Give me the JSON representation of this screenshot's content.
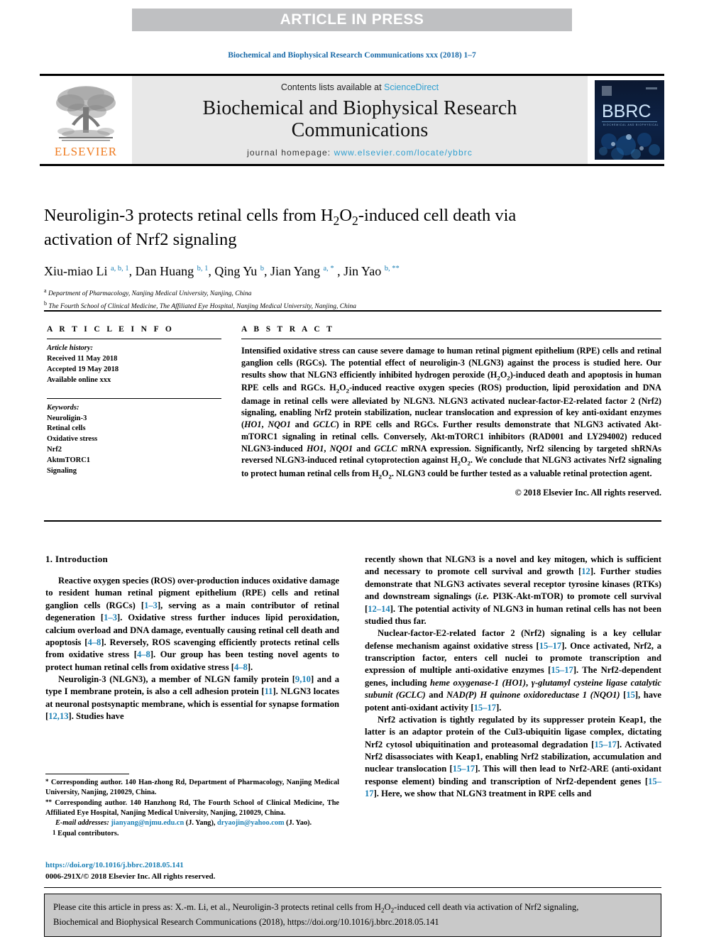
{
  "banner": {
    "text": "ARTICLE IN PRESS"
  },
  "journal_ref": "Biochemical and Biophysical Research Communications xxx (2018) 1–7",
  "masthead": {
    "contents_prefix": "Contents lists available at ",
    "sciencedirect": "ScienceDirect",
    "journal_title": "Biochemical and Biophysical Research Communications",
    "homepage_prefix": "journal homepage: ",
    "homepage_url": "www.elsevier.com/locate/ybbrc",
    "publisher": "ELSEVIER",
    "cover_label": "BBRC"
  },
  "article": {
    "title_line1": "Neuroligin-3 protects retinal cells from H",
    "title_sub1": "2",
    "title_mid": "O",
    "title_sub2": "2",
    "title_line1b": "-induced cell death via",
    "title_line2": "activation of Nrf2 signaling",
    "authors_html": "Xiu-miao Li <sup>a, b, 1</sup>, Dan Huang <sup>b, 1</sup>, Qing Yu <sup>b</sup>, Jian Yang <sup>a, *</sup> , Jin Yao <sup>b, **</sup>",
    "affiliation_a": "Department of Pharmacology, Nanjing Medical University, Nanjing, China",
    "affiliation_b": "The Fourth School of Clinical Medicine, The Affiliated Eye Hospital, Nanjing Medical University, Nanjing, China"
  },
  "article_info": {
    "heading": "A R T I C L E  I N F O",
    "history_label": "Article history:",
    "received": "Received 11 May 2018",
    "accepted": "Accepted 19 May 2018",
    "available": "Available online xxx",
    "keywords_label": "Keywords:",
    "keywords": [
      "Neuroligin-3",
      "Retinal cells",
      "Oxidative stress",
      "Nrf2",
      "AktmTORC1",
      "Signaling"
    ]
  },
  "abstract": {
    "heading": "A B S T R A C T",
    "copyright": "© 2018 Elsevier Inc. All rights reserved."
  },
  "sections": {
    "introduction_heading": "1. Introduction"
  },
  "footnotes": {
    "corr1": "Corresponding author. 140 Han-zhong Rd, Department of Pharmacology, Nanjing Medical University, Nanjing, 210029, China.",
    "corr2": "Corresponding author. 140 Hanzhong Rd, The Fourth School of Clinical Medicine, The Affiliated Eye Hospital, Nanjing Medical University, Nanjing, 210029, China.",
    "email_label": "E-mail addresses:",
    "email1": "jianyang@njmu.edu.cn",
    "email1_who": "(J. Yang)",
    "email2": "dryaojin@yahoo.com",
    "email2_who": "(J. Yao).",
    "equal": "Equal contributors.",
    "doi": "https://doi.org/10.1016/j.bbrc.2018.05.141",
    "issn_line": "0006-291X/© 2018 Elsevier Inc. All rights reserved."
  },
  "citation_footer": {
    "line1_a": "Please cite this article in press as: X.-m. Li, et al., Neuroligin-3 protects retinal cells from H",
    "line1_b": "-induced cell death via activation of Nrf2 signaling,",
    "line2": "Biochemical and Biophysical Research Communications (2018), https://doi.org/10.1016/j.bbrc.2018.05.141"
  },
  "colors": {
    "link_blue": "#1a7fb5",
    "sciencedirect_blue": "#2f9fd0",
    "elsevier_orange": "#ef7c22",
    "banner_gray": "#bfc0c2",
    "masthead_gray": "#e8e8e8",
    "citation_gray": "#c9c9c9"
  }
}
